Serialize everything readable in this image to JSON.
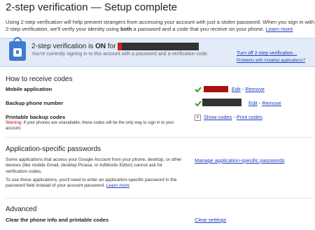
{
  "page": {
    "title": "2-step verification — Setup complete",
    "intro": {
      "part1": "Using 2-step verification will help prevent strangers from accessing your account with just a stolen password. When you sign in with 2-step verification, we'll verify your identity using ",
      "bold": "both",
      "part2": " a password and a code that you receive on your phone. ",
      "learn_more": "Learn more"
    }
  },
  "banner": {
    "status_prefix": "2-step verification is ",
    "status_value": "ON",
    "status_suffix": " for ",
    "subtext": "You're currently signing in to this account with a password and a verification code.",
    "turn_off_link": "Turn off 2-step verification...",
    "problems_link": "Problems with installed applications?"
  },
  "receive_codes": {
    "section_title": "How to receive codes",
    "rows": [
      {
        "label": "Mobile application",
        "edit": "Edit",
        "separator": " - ",
        "remove": "Remove"
      },
      {
        "label": "Backup phone number",
        "edit": "Edit",
        "separator": " - ",
        "remove": "Remove"
      }
    ],
    "printable": {
      "label": "Printable backup codes",
      "warning_label": "Warning:",
      "warning_text": " If your phones are unavailable, these codes will be the only way to sign in to your account.",
      "show_codes": "Show codes",
      "separator": " - ",
      "print_codes": "Print codes"
    }
  },
  "app_passwords": {
    "section_title": "Application-specific passwords",
    "desc1": "Some applications that access your Google Account from your phone, desktop, or other devices (like mobile Gmail, desktop Picasa, or AdWords Editor) cannot ask for verification codes.",
    "desc2": "To use these applications, you'll need to enter an application-specific password in the password field instead of your account password. ",
    "learn_more": "Learn more",
    "manage_link": "Manage application-specific passwords"
  },
  "advanced": {
    "section_title": "Advanced",
    "label": "Clear the phone info and printable codes",
    "clear_link": "Clear settings"
  },
  "colors": {
    "link": "#1a3dbd",
    "banner_bg": "#e3ebf9",
    "lock_blue": "#3f7ccf",
    "check_green": "#3c9a1f",
    "warning_red": "#cc0000"
  }
}
